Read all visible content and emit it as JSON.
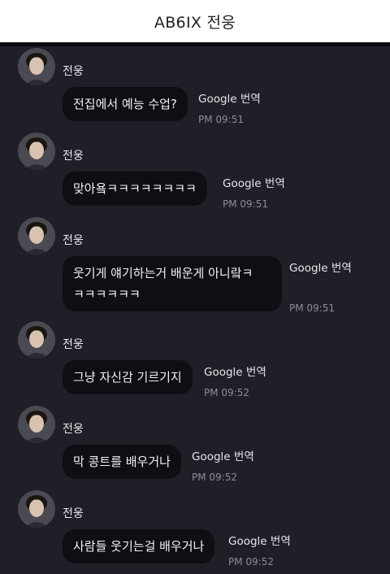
{
  "header": {
    "title": "AB6IX 전웅"
  },
  "messages": [
    {
      "sender": "전웅",
      "text": "전집에서 예능 수업?",
      "translate": "Google 번역",
      "time": "PM 09:51"
    },
    {
      "sender": "전웅",
      "text": "맞아욬ㅋㅋㅋㅋㅋㅋㅋㅋ",
      "translate": "Google 번역",
      "time": "PM 09:51"
    },
    {
      "sender": "전웅",
      "text_line1": "웃기게 얘기하는거 배운게 아니랔ㅋ",
      "text_line2": "ㅋㅋㅋㅋㅋㅋ",
      "translate": "Google 번역",
      "time": "PM 09:51"
    },
    {
      "sender": "전웅",
      "text": "그냥 자신감 기르기지",
      "translate": "Google 번역",
      "time": "PM 09:52"
    },
    {
      "sender": "전웅",
      "text": "막 콩트를 배우거나",
      "translate": "Google 번역",
      "time": "PM 09:52"
    },
    {
      "sender": "전웅",
      "text": "사람들 웃기는걸 배우거나",
      "translate": "Google 번역",
      "time": "PM 09:52"
    }
  ]
}
